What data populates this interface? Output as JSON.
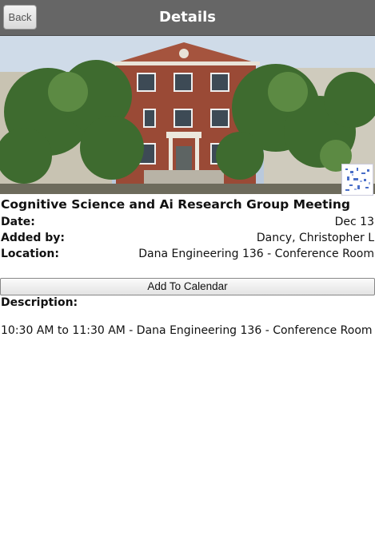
{
  "header": {
    "back_label": "Back",
    "title": "Details"
  },
  "event": {
    "title": "Cognitive Science and Ai Research Group Meeting",
    "fields": {
      "date_label": "Date:",
      "date_value": "Dec 13",
      "added_by_label": "Added by:",
      "added_by_value": "Dancy, Christopher L",
      "location_label": "Location:",
      "location_value": "Dana Engineering 136 - Conference Room"
    },
    "add_to_calendar_label": "Add To Calendar",
    "description_label": "Description:",
    "description_text": "10:30 AM to 11:30 AM - Dana Engineering 136 - Conference Room"
  },
  "colors": {
    "header_bg": "#666666",
    "header_text": "#ffffff"
  }
}
